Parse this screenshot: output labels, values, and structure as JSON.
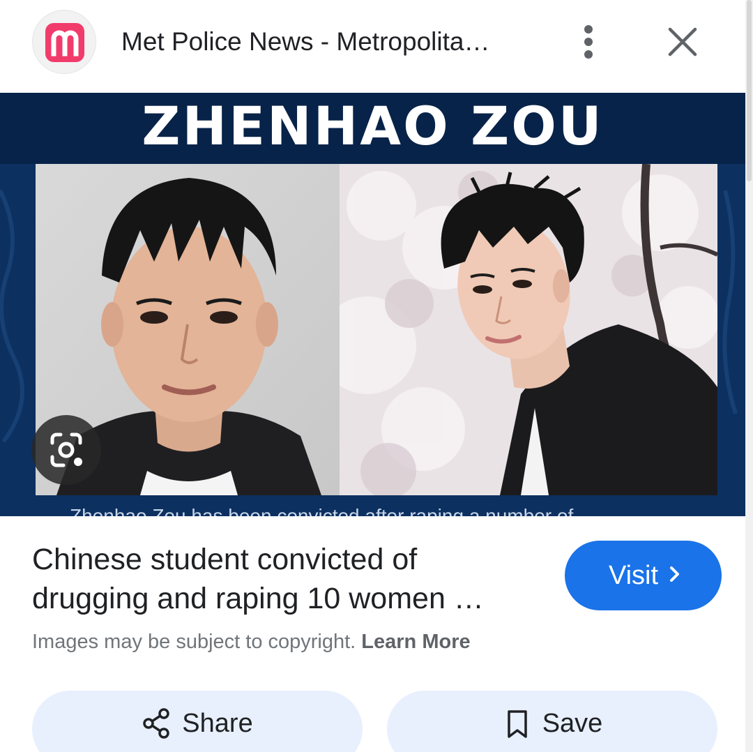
{
  "header": {
    "favicon_letter": "m",
    "site_title": "Met Police News - Metropolita…",
    "icons": {
      "more": "more-vert-icon",
      "close": "close-icon"
    }
  },
  "image": {
    "banner_text": "ZHENHAO ZOU",
    "caption_partial": "Zhenhao Zou has been convicted after raping a number of"
  },
  "result": {
    "title_line1": "Chinese student convicted of",
    "title_line2": "drugging and raping 10 women …",
    "visit_label": "Visit",
    "copyright_text": "Images may be subject to copyright.",
    "learn_more": "Learn More"
  },
  "actions": {
    "share_label": "Share",
    "save_label": "Save"
  },
  "colors": {
    "accent": "#1a73e8",
    "favicon": "#f13c6b",
    "banner_bg": "#0b2b55",
    "action_bg": "#e8f0fe"
  }
}
